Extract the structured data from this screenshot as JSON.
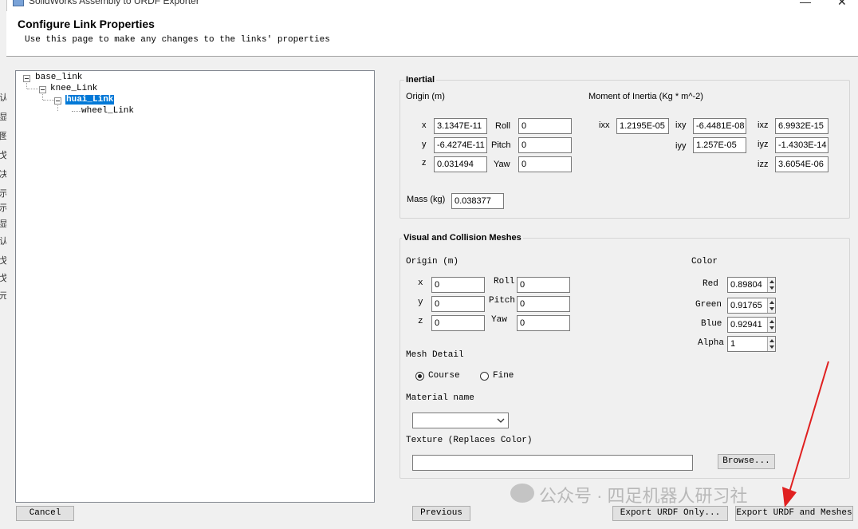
{
  "window": {
    "title": "SolidWorks Assembly to URDF Exporter"
  },
  "left_strip_chars": [
    "认",
    "显",
    "图",
    "戈",
    "决",
    "示",
    "示",
    "显",
    "认",
    "戈",
    "戈",
    "元"
  ],
  "header": {
    "title": "Configure Link Properties",
    "subtitle": "Use this page to make any changes to the links' properties"
  },
  "tree": {
    "nodes": [
      {
        "label": "base_link",
        "selected": false
      },
      {
        "label": "knee_Link",
        "selected": false
      },
      {
        "label": "huai_Link",
        "selected": true
      },
      {
        "label": "wheel_Link",
        "selected": false
      }
    ]
  },
  "inertial": {
    "group_title": "Inertial",
    "origin_label": "Origin (m)",
    "moment_label": "Moment of Inertia (Kg * m^-2)",
    "x_label": "x",
    "y_label": "y",
    "z_label": "z",
    "roll_label": "Roll",
    "pitch_label": "Pitch",
    "yaw_label": "Yaw",
    "x": "3.1347E-11",
    "y": "-6.4274E-11",
    "z": "0.031494",
    "roll": "0",
    "pitch": "0",
    "yaw": "0",
    "ixx_label": "ixx",
    "ixy_label": "ixy",
    "ixz_label": "ixz",
    "iyy_label": "iyy",
    "iyz_label": "iyz",
    "izz_label": "izz",
    "ixx": "1.2195E-05",
    "ixy": "-6.4481E-08",
    "ixz": "6.9932E-15",
    "iyy": "1.257E-05",
    "iyz": "-1.4303E-14",
    "izz": "3.6054E-06",
    "mass_label": "Mass (kg)",
    "mass": "0.038377"
  },
  "visual": {
    "group_title": "Visual and Collision Meshes",
    "origin_label": "Origin (m)",
    "x_label": "x",
    "y_label": "y",
    "z_label": "z",
    "roll_label": "Roll",
    "pitch_label": "Pitch",
    "yaw_label": "Yaw",
    "x": "0",
    "y": "0",
    "z": "0",
    "roll": "0",
    "pitch": "0",
    "yaw": "0",
    "color_label": "Color",
    "red_label": "Red",
    "green_label": "Green",
    "blue_label": "Blue",
    "alpha_label": "Alpha",
    "red": "0.89804",
    "green": "0.91765",
    "blue": "0.92941",
    "alpha": "1",
    "mesh_detail_label": "Mesh Detail",
    "course_label": "Course",
    "fine_label": "Fine",
    "mesh_detail_selected": "Course",
    "material_label": "Material name",
    "material_value": "",
    "texture_label": "Texture (Replaces Color)",
    "texture_value": "",
    "browse_label": "Browse..."
  },
  "buttons": {
    "cancel": "Cancel",
    "previous": "Previous",
    "export_urdf": "Export URDF Only...",
    "export_meshes": "Export URDF and Meshes"
  },
  "watermark": "公众号 · 四足机器人研习社",
  "colors": {
    "selection": "#0078d7",
    "annotation_arrow": "#e02020"
  }
}
